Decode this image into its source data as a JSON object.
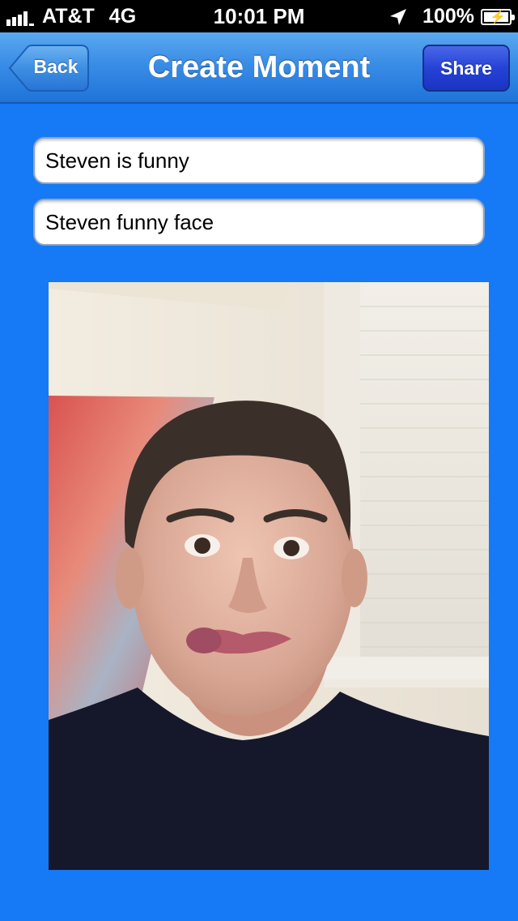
{
  "status_bar": {
    "carrier": "AT&T",
    "network": "4G",
    "time": "10:01 PM",
    "battery": "100%",
    "icons": [
      "signal-icon",
      "location-arrow-icon",
      "battery-charging-icon"
    ]
  },
  "nav": {
    "title": "Create Moment",
    "back_label": "Back",
    "share_label": "Share"
  },
  "form": {
    "title_value": "Steven is funny",
    "description_value": "Steven funny face"
  },
  "photo": {
    "subject": "selfie-photo"
  },
  "colors": {
    "background": "#1679f5",
    "nav_bar": "#3a8de6",
    "share_button": "#2642d6"
  }
}
